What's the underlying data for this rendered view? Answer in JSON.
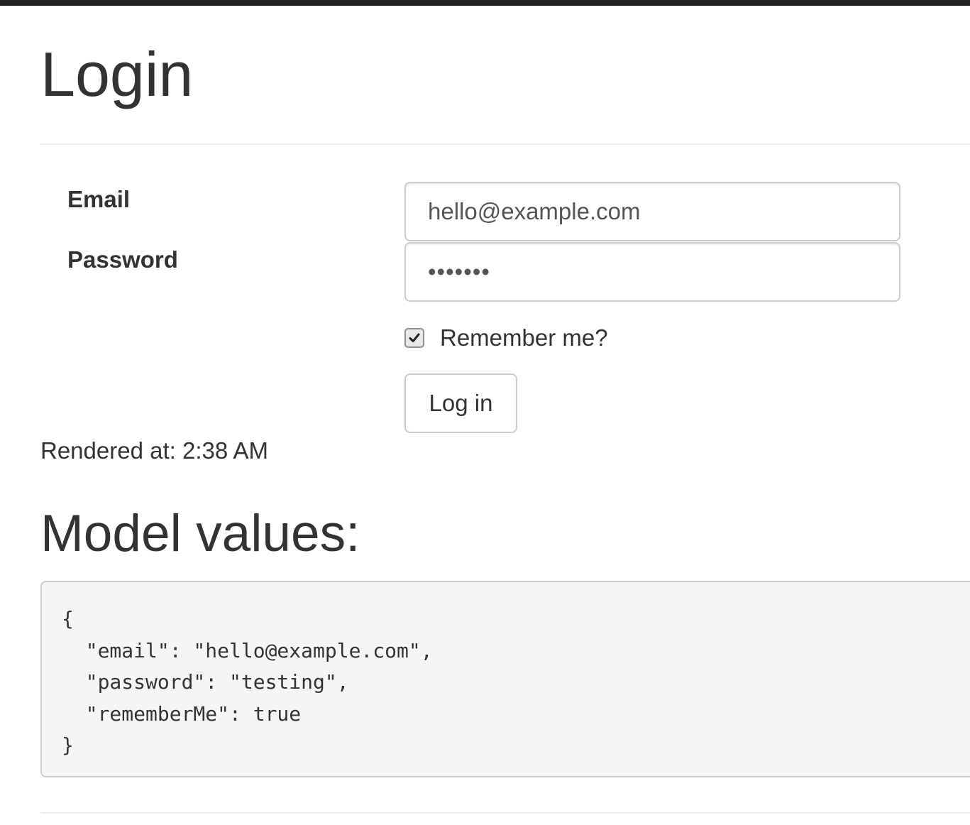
{
  "page": {
    "title": "Login"
  },
  "form": {
    "email_label": "Email",
    "email_value": "hello@example.com",
    "password_label": "Password",
    "password_display": "•••••••",
    "remember_label": "Remember me?",
    "remember_checked": true,
    "submit_label": "Log in"
  },
  "rendered_at": "Rendered at: 2:38 AM",
  "model": {
    "title": "Model values:",
    "json_text": "{\n  \"email\": \"hello@example.com\",\n  \"password\": \"testing\",\n  \"rememberMe\": true\n}"
  },
  "colors": {
    "text": "#333333",
    "top_bar": "#222222",
    "input_border": "#cccccc",
    "pre_background": "#f5f5f5",
    "rule": "#eeeeee"
  },
  "icons": {
    "checkbox": "checkmark-icon"
  }
}
